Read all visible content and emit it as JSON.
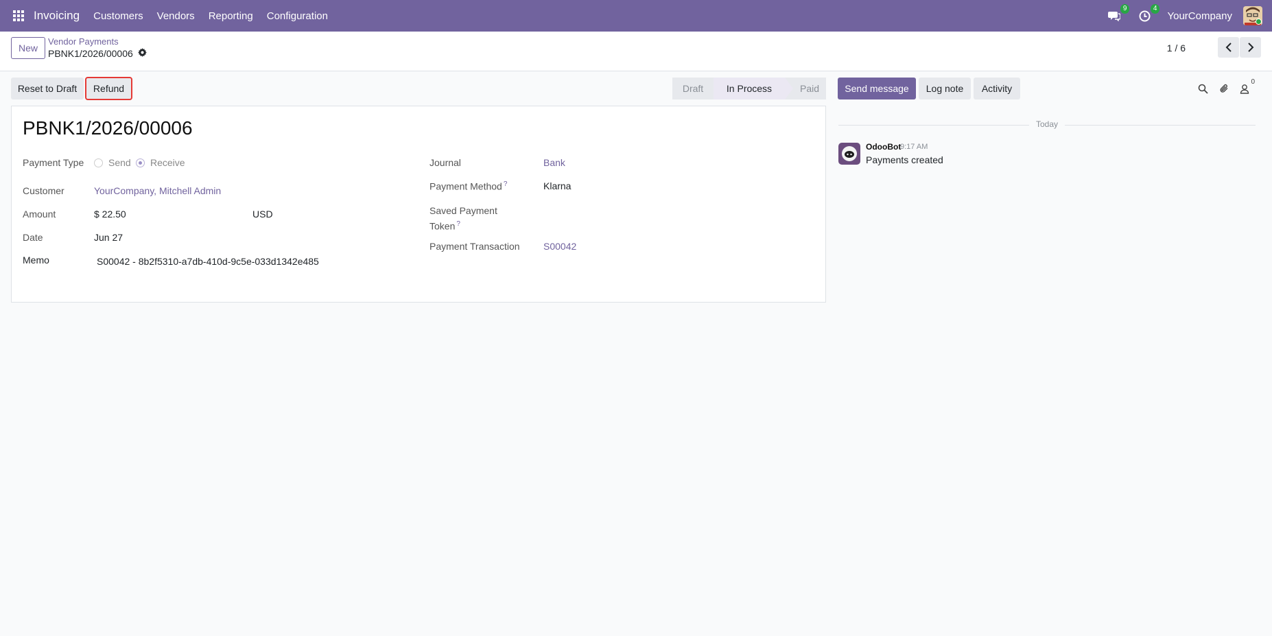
{
  "topbar": {
    "app_title": "Invoicing",
    "menu": [
      "Customers",
      "Vendors",
      "Reporting",
      "Configuration"
    ],
    "messages_count": "9",
    "activities_count": "4",
    "company": "YourCompany"
  },
  "control": {
    "new_label": "New",
    "breadcrumb_parent": "Vendor Payments",
    "breadcrumb_current": "PBNK1/2026/00006",
    "pager": "1 / 6"
  },
  "actions": {
    "reset_label": "Reset to Draft",
    "refund_label": "Refund"
  },
  "status": {
    "steps": [
      "Draft",
      "In Process",
      "Paid"
    ],
    "current": "In Process"
  },
  "record": {
    "title": "PBNK1/2026/00006",
    "payment_type_label": "Payment Type",
    "payment_type_options": [
      "Send",
      "Receive"
    ],
    "payment_type_selected": "Receive",
    "customer_label": "Customer",
    "customer_value": "YourCompany, Mitchell Admin",
    "amount_label": "Amount",
    "amount_value": "$ 22.50",
    "currency_value": "USD",
    "date_label": "Date",
    "date_value": "Jun 27",
    "memo_label": "Memo",
    "memo_value": "S00042 - 8b2f5310-a7db-410d-9c5e-033d1342e485",
    "journal_label": "Journal",
    "journal_value": "Bank",
    "payment_method_label": "Payment Method",
    "payment_method_value": "Klarna",
    "saved_token_label_line1": "Saved Payment",
    "saved_token_label_line2": "Token",
    "help_mark": "?",
    "transaction_label": "Payment Transaction",
    "transaction_value": "S00042"
  },
  "chatter": {
    "send_message_label": "Send message",
    "log_note_label": "Log note",
    "activity_label": "Activity",
    "followers_count": "0",
    "date_separator": "Today",
    "messages": [
      {
        "author": "OdooBot",
        "time": "9:17 AM",
        "body": "Payments created"
      }
    ]
  },
  "colors": {
    "brand": "#71639e",
    "badge": "#28a745",
    "highlight": "#e53935"
  }
}
